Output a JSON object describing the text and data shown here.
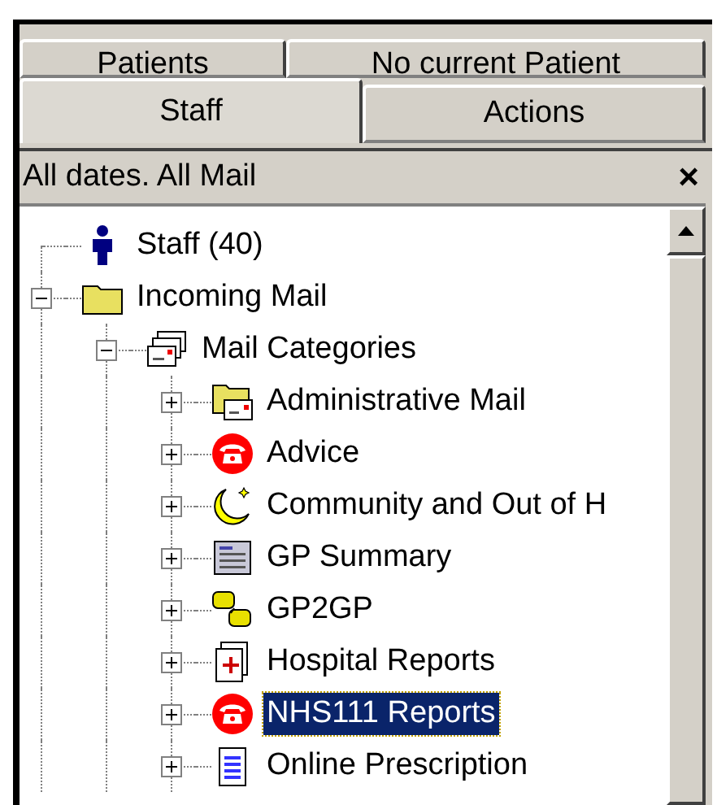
{
  "tab_rows": [
    [
      {
        "label": "Patients",
        "selected": false
      },
      {
        "label": "No current Patient",
        "selected": false
      }
    ],
    [
      {
        "label": "Staff",
        "selected": true
      },
      {
        "label": "Actions",
        "selected": false
      }
    ]
  ],
  "panel": {
    "title": "All dates. All Mail",
    "close": "×"
  },
  "tree": [
    {
      "label": "Staff (40)",
      "kind": "person",
      "selected": false
    },
    {
      "label": "Incoming Mail",
      "kind": "folder",
      "expanded": true,
      "selected": false,
      "children": [
        {
          "label": "Mail Categories",
          "kind": "mail-stack",
          "expanded": true,
          "selected": false,
          "children": [
            {
              "label": "Administrative Mail",
              "kind": "mail-folder",
              "expanded": false,
              "selected": false
            },
            {
              "label": "Advice",
              "kind": "phone",
              "expanded": false,
              "selected": false
            },
            {
              "label": "Community and Out of H",
              "kind": "moon",
              "expanded": false,
              "selected": false
            },
            {
              "label": "GP Summary",
              "kind": "summary",
              "expanded": false,
              "selected": false
            },
            {
              "label": "GP2GP",
              "kind": "gp",
              "expanded": false,
              "selected": false
            },
            {
              "label": "Hospital Reports",
              "kind": "medical",
              "expanded": false,
              "selected": false
            },
            {
              "label": "NHS111 Reports",
              "kind": "phone",
              "expanded": false,
              "selected": true
            },
            {
              "label": "Online Prescription",
              "kind": "notepad",
              "expanded": false,
              "selected": false
            }
          ]
        }
      ]
    }
  ]
}
